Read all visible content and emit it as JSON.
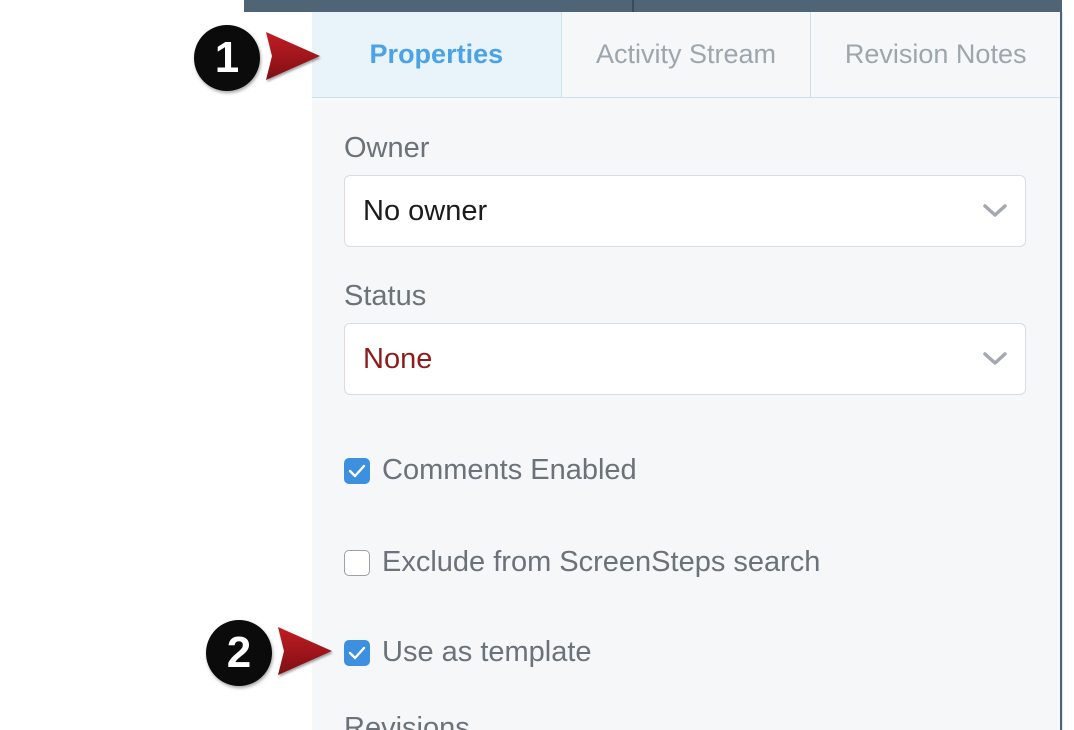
{
  "tabs": [
    {
      "label": "Properties",
      "active": true
    },
    {
      "label": "Activity Stream",
      "active": false
    },
    {
      "label": "Revision Notes",
      "active": false
    }
  ],
  "owner": {
    "label": "Owner",
    "value": "No owner"
  },
  "status": {
    "label": "Status",
    "value": "None",
    "value_color": "#8e1c1c"
  },
  "options": {
    "comments_enabled": {
      "label": "Comments Enabled",
      "checked": true
    },
    "exclude_search": {
      "label": "Exclude from ScreenSteps search",
      "checked": false
    },
    "use_as_template": {
      "label": "Use as template",
      "checked": true
    }
  },
  "revisions": {
    "label": "Revisions"
  },
  "callouts": [
    {
      "number": "1",
      "icon": "red-arrow-icon"
    },
    {
      "number": "2",
      "icon": "red-arrow-icon"
    }
  ],
  "colors": {
    "accent": "#4aa3e6",
    "checkbox": "#3d8fe0",
    "callout_arrow": "#a5141b"
  }
}
